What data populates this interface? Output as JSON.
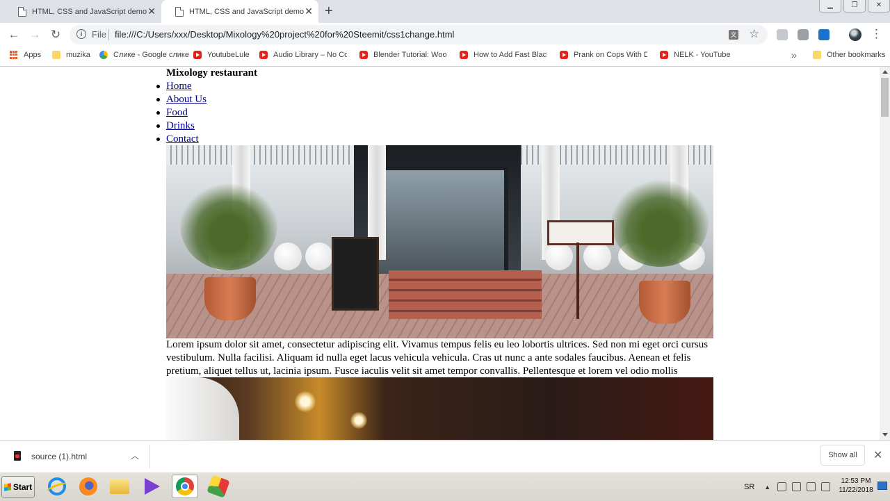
{
  "browser": {
    "tabs": [
      {
        "title": "HTML, CSS and JavaScript demo - Li",
        "active": false
      },
      {
        "title": "HTML, CSS and JavaScript demo",
        "active": true
      }
    ],
    "new_tab_icon": "plus-icon",
    "omnibox": {
      "scheme_label": "File",
      "url": "file:///C:/Users/xxx/Desktop/Mixology%20project%20for%20Steemit/css1change.html"
    },
    "bookmarks": [
      {
        "label": "Apps",
        "icon": "apps-grid-icon"
      },
      {
        "label": "muzika",
        "icon": "folder-icon"
      },
      {
        "label": "Слике - Google слике",
        "icon": "google-photos-icon"
      },
      {
        "label": "YoutubeLule",
        "icon": "youtube-icon"
      },
      {
        "label": "Audio Library – No Cop",
        "icon": "youtube-icon"
      },
      {
        "label": "Blender Tutorial: Wood",
        "icon": "youtube-icon"
      },
      {
        "label": "How to Add Fast Black",
        "icon": "youtube-icon"
      },
      {
        "label": "Prank on Cops With Do",
        "icon": "youtube-icon"
      },
      {
        "label": "NELK - YouTube",
        "icon": "youtube-icon"
      }
    ],
    "bookmarks_overflow": "»",
    "other_bookmarks": "Other bookmarks"
  },
  "page": {
    "title": "Mixology restaurant",
    "nav": [
      "Home",
      "About Us",
      "Food",
      "Drinks",
      "Contact"
    ],
    "paragraph": "Lorem ipsum dolor sit amet, consectetur adipiscing elit. Vivamus tempus felis eu leo lobortis ultrices. Sed non mi eget orci cursus vestibulum. Nulla facilisi. Aliquam id nulla eget lacus vehicula vehicula. Cras ut nunc a ante sodales faucibus. Aenean et felis pretium, aliquet tellus ut, lacinia ipsum. Fusce iaculis velit sit amet tempor convallis. Pellentesque et lorem vel odio mollis maximus. ."
  },
  "downloads": {
    "file_name": "source (1).html",
    "show_all": "Show all"
  },
  "taskbar": {
    "start_label": "Start",
    "language": "SR",
    "time": "12:53 PM",
    "date": "11/22/2018"
  }
}
